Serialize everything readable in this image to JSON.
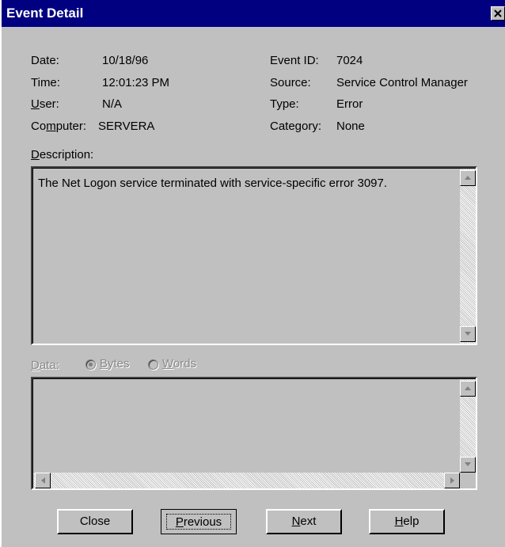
{
  "window": {
    "title": "Event Detail"
  },
  "info": {
    "date_label": "Date:",
    "date_value": "10/18/96",
    "time_label": "Time:",
    "time_value": "12:01:23 PM",
    "user_label": "User:",
    "user_value": "N/A",
    "computer_label": "Computer:",
    "computer_value": "SERVERA",
    "eventid_label": "Event ID:",
    "eventid_value": "7024",
    "source_label": "Source:",
    "source_value": "Service Control Manager",
    "type_label": "Type:",
    "type_value": "Error",
    "category_label": "Category:",
    "category_value": "None"
  },
  "description": {
    "label": "Description:",
    "text": "The Net Logon service terminated with service-specific error 3097."
  },
  "data_section": {
    "label": "Data:",
    "bytes_label": "Bytes",
    "words_label": "Words",
    "selected": "Bytes"
  },
  "buttons": {
    "close": "Close",
    "previous": "Previous",
    "next": "Next",
    "help": "Help"
  },
  "icons": {
    "close": "close-icon",
    "up": "arrow-up-icon",
    "down": "arrow-down-icon",
    "left": "arrow-left-icon",
    "right": "arrow-right-icon"
  }
}
